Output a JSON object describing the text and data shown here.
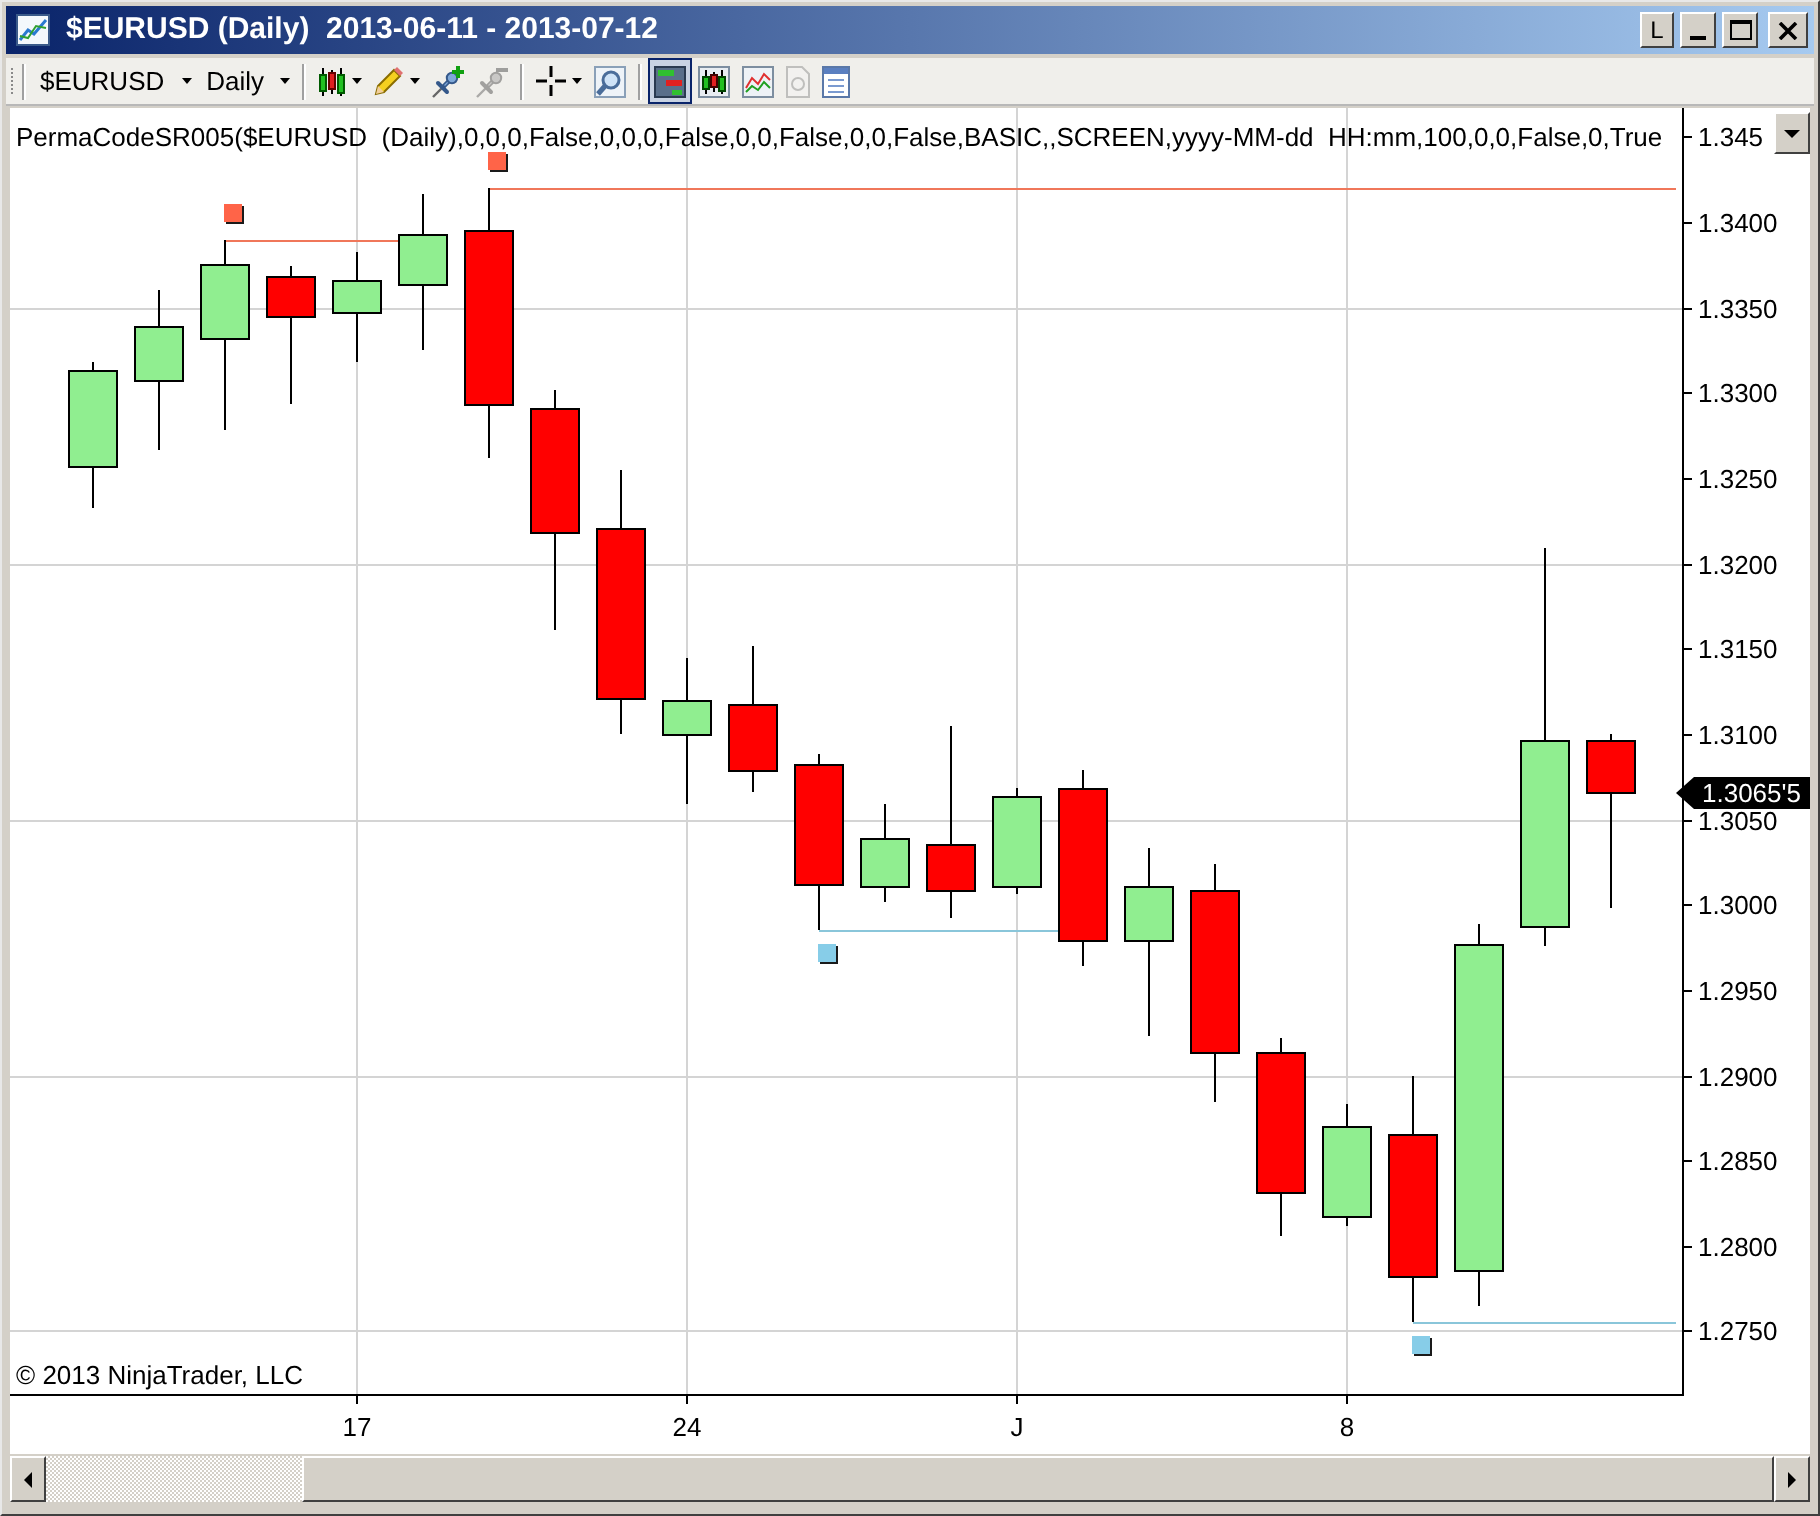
{
  "window": {
    "title": "$EURUSD (Daily)  2013-06-11 - 2013-07-12",
    "buttons": [
      {
        "kind": "text",
        "label": "L"
      },
      {
        "kind": "minimize"
      },
      {
        "kind": "maximize"
      },
      {
        "kind": "close"
      }
    ]
  },
  "toolbar": {
    "instrument": "$EURUSD",
    "interval": "Daily",
    "tool_groups": [
      [
        {
          "dropdown": true,
          "selected": false,
          "disabled": false
        },
        {
          "dropdown": true,
          "selected": false,
          "disabled": false
        },
        {
          "dropdown": false,
          "selected": false,
          "disabled": false
        },
        {
          "dropdown": false,
          "selected": false,
          "disabled": true
        }
      ],
      [
        {
          "dropdown": true,
          "selected": false,
          "disabled": false
        },
        {
          "dropdown": false,
          "selected": false,
          "disabled": false
        }
      ],
      [
        {
          "dropdown": false,
          "selected": true,
          "disabled": false
        },
        {
          "dropdown": false,
          "selected": false,
          "disabled": false
        },
        {
          "dropdown": false,
          "selected": false,
          "disabled": false
        },
        {
          "dropdown": false,
          "selected": false,
          "disabled": true
        },
        {
          "dropdown": false,
          "selected": false,
          "disabled": false
        }
      ]
    ]
  },
  "chart": {
    "indicator_label": "PermaCodeSR005($EURUSD  (Daily),0,0,0,False,0,0,0,False,0,0,False,0,0,False,BASIC,,SCREEN,yyyy-MM-dd  HH:mm,100,0,0,False,0,True",
    "copyright": "© 2013 NinjaTrader, LLC",
    "last_price": "1.3065'5",
    "price_labels": [
      "1.345",
      "1.3400",
      "1.3350",
      "1.3300",
      "1.3250",
      "1.3200",
      "1.3150",
      "1.3100",
      "1.3050",
      "1.3000",
      "1.2950",
      "1.2900",
      "1.2850",
      "1.2800",
      "1.2750"
    ],
    "date_labels": [
      "17",
      "24",
      "J",
      "8"
    ]
  }
}
